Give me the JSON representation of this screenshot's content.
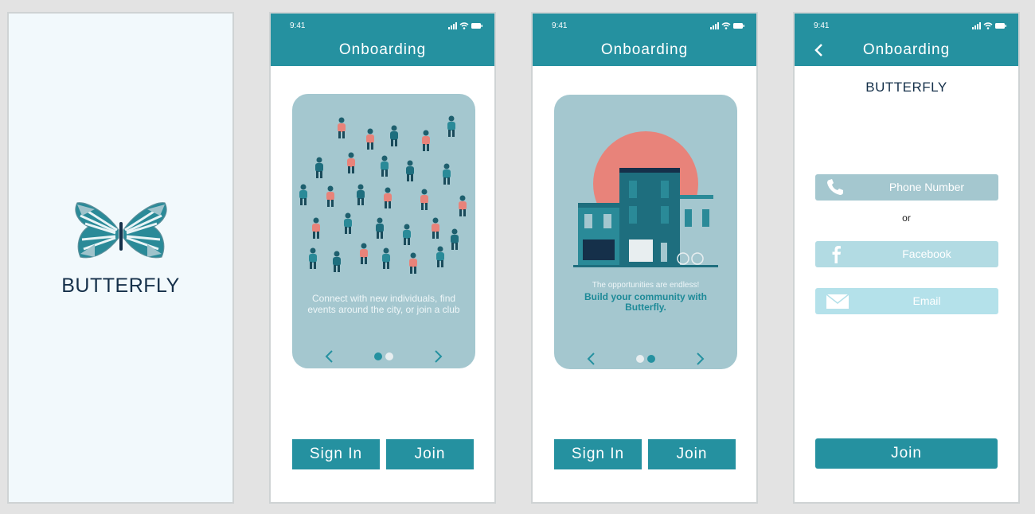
{
  "colors": {
    "brand_teal": "#2591a0",
    "card_bg": "#a4c7cf",
    "coral": "#e8837a",
    "navy": "#15304a"
  },
  "screens": {
    "splash": {
      "app_name": "BUTTERFLY",
      "logo": "butterfly-logo"
    },
    "onboarding1": {
      "status_time": "9:41",
      "title": "Onboarding",
      "caption": "Connect with new individuals, find events around the city, or join a club",
      "active_page": 1,
      "page_count": 2,
      "sign_in_label": "Sign In",
      "join_label": "Join"
    },
    "onboarding2": {
      "status_time": "9:41",
      "title": "Onboarding",
      "caption_small": "The opportunities are endless!",
      "caption_strong": "Build your community with Butterfly.",
      "active_page": 2,
      "page_count": 2,
      "sign_in_label": "Sign In",
      "join_label": "Join"
    },
    "login": {
      "status_time": "9:41",
      "title": "Onboarding",
      "brand": "BUTTERFLY",
      "phone_label": "Phone Number",
      "or_label": "or",
      "facebook_label": "Facebook",
      "email_label": "Email",
      "join_label": "Join"
    }
  }
}
